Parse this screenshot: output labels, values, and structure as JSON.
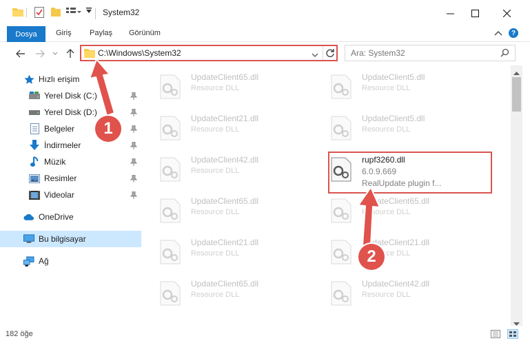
{
  "window": {
    "title": "System32"
  },
  "ribbon": {
    "file_tab": "Dosya",
    "tabs": [
      "Giriş",
      "Paylaş",
      "Görünüm"
    ]
  },
  "address": {
    "path": "C:\\Windows\\System32"
  },
  "search": {
    "placeholder": "Ara: System32"
  },
  "sidebar": {
    "items": [
      {
        "label": "Hızlı erişim",
        "icon": "star-icon",
        "pinned": false
      },
      {
        "label": "Yerel Disk (C:)",
        "icon": "drive-icon",
        "pinned": true
      },
      {
        "label": "Yerel Disk (D:)",
        "icon": "drive-icon",
        "pinned": true
      },
      {
        "label": "Belgeler",
        "icon": "documents-icon",
        "pinned": true
      },
      {
        "label": "İndirmeler",
        "icon": "download-icon",
        "pinned": true
      },
      {
        "label": "Müzik",
        "icon": "music-icon",
        "pinned": true
      },
      {
        "label": "Resimler",
        "icon": "pictures-icon",
        "pinned": true
      },
      {
        "label": "Videolar",
        "icon": "videos-icon",
        "pinned": true
      },
      {
        "label": "OneDrive",
        "icon": "cloud-icon",
        "pinned": false
      },
      {
        "label": "Bu bilgisayar",
        "icon": "computer-icon",
        "pinned": false,
        "selected": true
      },
      {
        "label": "Ağ",
        "icon": "network-icon",
        "pinned": false
      }
    ]
  },
  "files": {
    "left": [
      {
        "name": "UpdateClient65.dll",
        "type": "Resource DLL"
      },
      {
        "name": "UpdateClient21.dll",
        "type": "Resource DLL"
      },
      {
        "name": "UpdateClient42.dll",
        "type": "Resource DLL"
      },
      {
        "name": "UpdateClient65.dll",
        "type": "Resource DLL"
      },
      {
        "name": "UpdateClient21.dll",
        "type": "Resource DLL"
      },
      {
        "name": "UpdateClient65.dll",
        "type": "Resource DLL"
      }
    ],
    "right": [
      {
        "name": "UpdateClient5.dll",
        "type": "Resource DLL"
      },
      {
        "name": "UpdateClient5.dll",
        "type": "Resource DLL"
      },
      {
        "name": "UpdateClient65.dll",
        "type": "Resource DLL"
      },
      {
        "name": "UpdateClient21.dll",
        "type": "Resource DLL"
      },
      {
        "name": "UpdateClient42.dll",
        "type": "Resource DLL"
      }
    ],
    "highlighted": {
      "name": "rupf3260.dll",
      "version": "6.0.9.669",
      "description": "RealUpdate plugin f..."
    }
  },
  "status": {
    "count": "182 öğe"
  },
  "annotations": {
    "step1": "1",
    "step2": "2"
  },
  "colors": {
    "accent": "#1979ca",
    "annotation": "#e0524c",
    "selected": "#cce8ff"
  }
}
